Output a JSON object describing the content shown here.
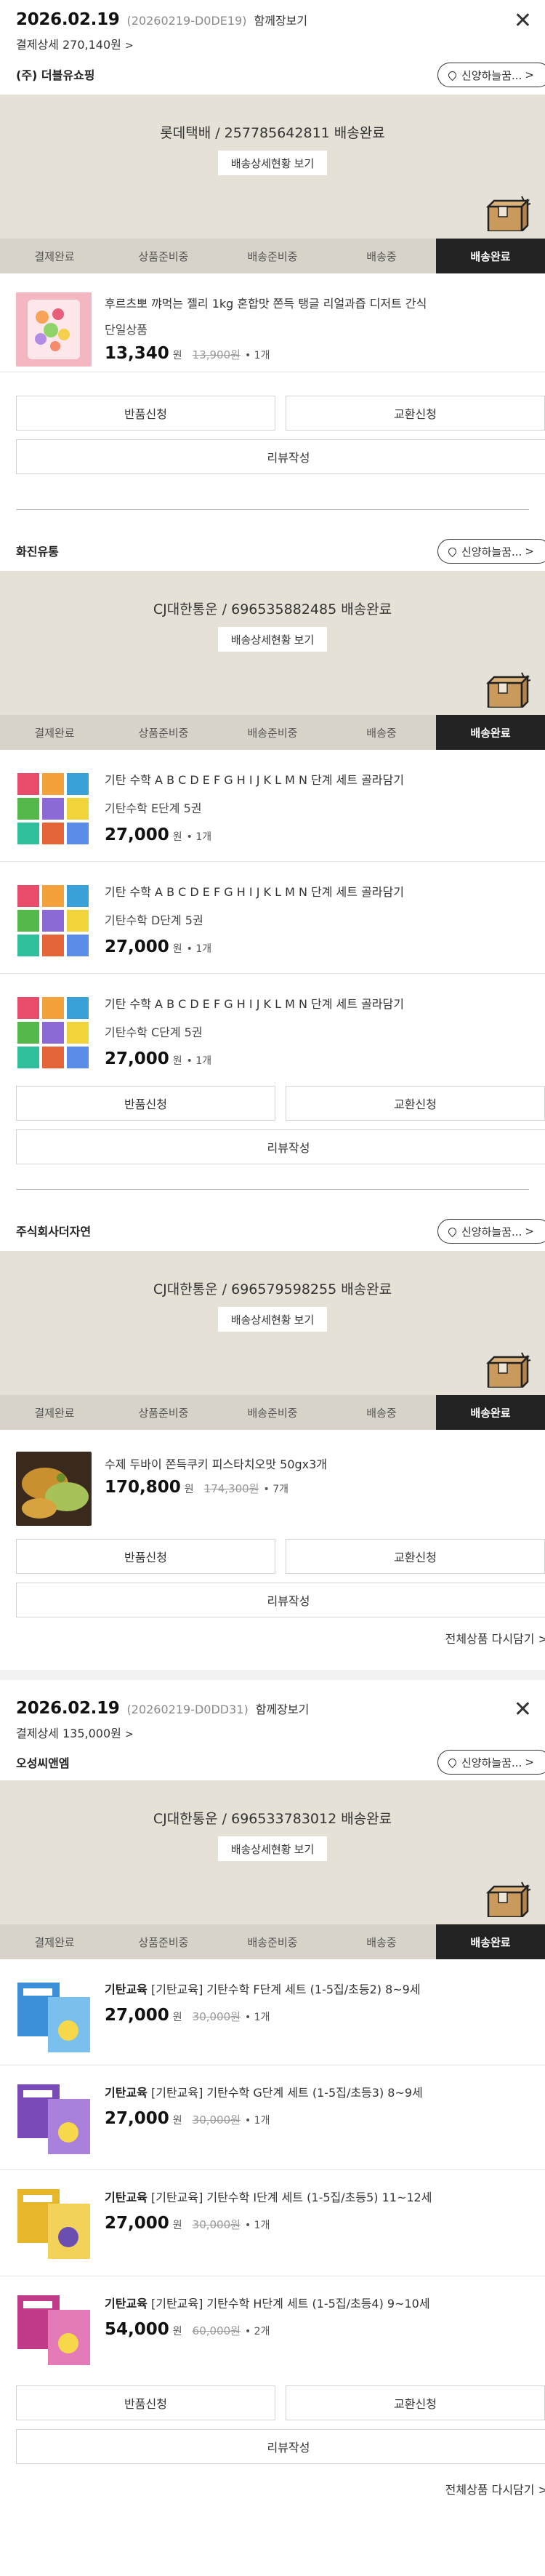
{
  "common": {
    "step_labels": [
      "결제완료",
      "상품준비중",
      "배송준비중",
      "배송중",
      "배송완료"
    ],
    "tracking_button": "배송상세현황 보기",
    "return_button": "반품신청",
    "exchange_button": "교환신청",
    "review_button": "리뷰작성",
    "won": "원",
    "chevron": ">",
    "close": "✕"
  },
  "orders": [
    {
      "date": "2026.02.19",
      "order_no": "(20260219-D0DE19)",
      "receipt": "함께장보기",
      "payment_detail": "결제상세 270,140원",
      "groups": [
        {
          "seller": "(주) 더블유쇼핑",
          "store_button": "신양하늘꿈...",
          "banner": "롯데택배 / 257785642811 배송완료",
          "items": [
            {
              "name": "후르츠뽀 꺄먹는 젤리 1kg 혼합맛 쫀득 탱글 리얼과즙 디저트 간식",
              "option": "단일상품",
              "price": "13,340",
              "original": "13,900원",
              "qty": "• 1개"
            }
          ]
        },
        {
          "seller": "화진유통",
          "store_button": "신양하늘꿈...",
          "banner": "CJ대한통운 / 696535882485 배송완료",
          "items": [
            {
              "name": "기탄 수학 A B C D E F G H I J K L M N 단계 세트 골라담기",
              "option": "기탄수학 E단계 5권",
              "price": "27,000",
              "original": "",
              "qty": "• 1개"
            },
            {
              "name": "기탄 수학 A B C D E F G H I J K L M N 단계 세트 골라담기",
              "option": "기탄수학 D단계 5권",
              "price": "27,000",
              "original": "",
              "qty": "• 1개"
            },
            {
              "name": "기탄 수학 A B C D E F G H I J K L M N 단계 세트 골라담기",
              "option": "기탄수학 C단계 5권",
              "price": "27,000",
              "original": "",
              "qty": "• 1개"
            }
          ]
        },
        {
          "seller": "주식회사더자연",
          "store_button": "신양하늘꿈...",
          "banner": "CJ대한통운 / 696579598255 배송완료",
          "items": [
            {
              "name": "수제 두바이 쫀득쿠키 피스타치오맛 50gx3개",
              "option": "",
              "price": "170,800",
              "original": "174,300원",
              "qty": "• 7개"
            }
          ]
        }
      ],
      "repurchase": "전체상품 다시담기 >"
    },
    {
      "date": "2026.02.19",
      "order_no": "(20260219-D0DD31)",
      "receipt": "함께장보기",
      "payment_detail": "결제상세 135,000원",
      "groups": [
        {
          "seller": "오성씨앤엠",
          "store_button": "신양하늘꿈...",
          "banner": "CJ대한통운 / 696533783012 배송완료",
          "items": [
            {
              "brand": "기탄교육",
              "name": "[기탄교육] 기탄수학 F단계 세트 (1-5집/초등2) 8~9세",
              "option": "",
              "price": "27,000",
              "original": "30,000원",
              "qty": "• 1개"
            },
            {
              "brand": "기탄교육",
              "name": "[기탄교육] 기탄수학 G단계 세트 (1-5집/초등3) 8~9세",
              "option": "",
              "price": "27,000",
              "original": "30,000원",
              "qty": "• 1개"
            },
            {
              "brand": "기탄교육",
              "name": "[기탄교육] 기탄수학 I단계 세트 (1-5집/초등5) 11~12세",
              "option": "",
              "price": "27,000",
              "original": "30,000원",
              "qty": "• 1개"
            },
            {
              "brand": "기탄교육",
              "name": "[기탄교육] 기탄수학 H단계 세트 (1-5집/초등4) 9~10세",
              "option": "",
              "price": "54,000",
              "original": "60,000원",
              "qty": "• 2개"
            }
          ]
        }
      ],
      "repurchase": "전체상품 다시담기 >"
    }
  ],
  "colors": {
    "banner_bg": "#e6e1d6",
    "step_bar": "#d8d3c8",
    "step_active": "#222222"
  },
  "icons": [
    "close-icon",
    "chevron-right-icon",
    "location-pin-icon",
    "delivery-box-icon"
  ]
}
